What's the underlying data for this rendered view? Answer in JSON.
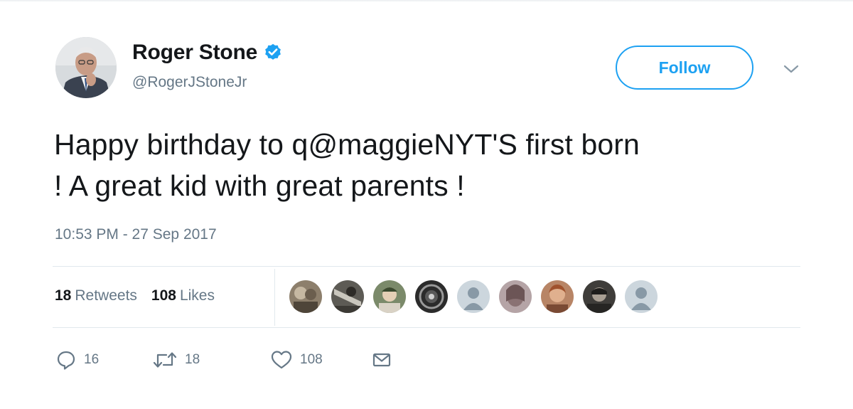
{
  "tweet": {
    "author": {
      "display_name": "Roger Stone",
      "handle": "@RogerJStoneJr",
      "verified_icon": "verified-badge-icon"
    },
    "follow_label": "Follow",
    "text_lines": [
      "Happy birthday to q@maggieNYT'S first born",
      "! A great kid with great parents !"
    ],
    "timestamp": "10:53 PM - 27 Sep 2017",
    "stats": {
      "retweets_count": "18",
      "retweets_label": "Retweets",
      "likes_count": "108",
      "likes_label": "Likes"
    },
    "actions": {
      "reply_count": "16",
      "retweet_count": "18",
      "like_count": "108"
    }
  },
  "colors": {
    "accent": "#1da1f2",
    "secondary_text": "#657786",
    "primary_text": "#14171a",
    "divider": "#e1e8ed"
  }
}
